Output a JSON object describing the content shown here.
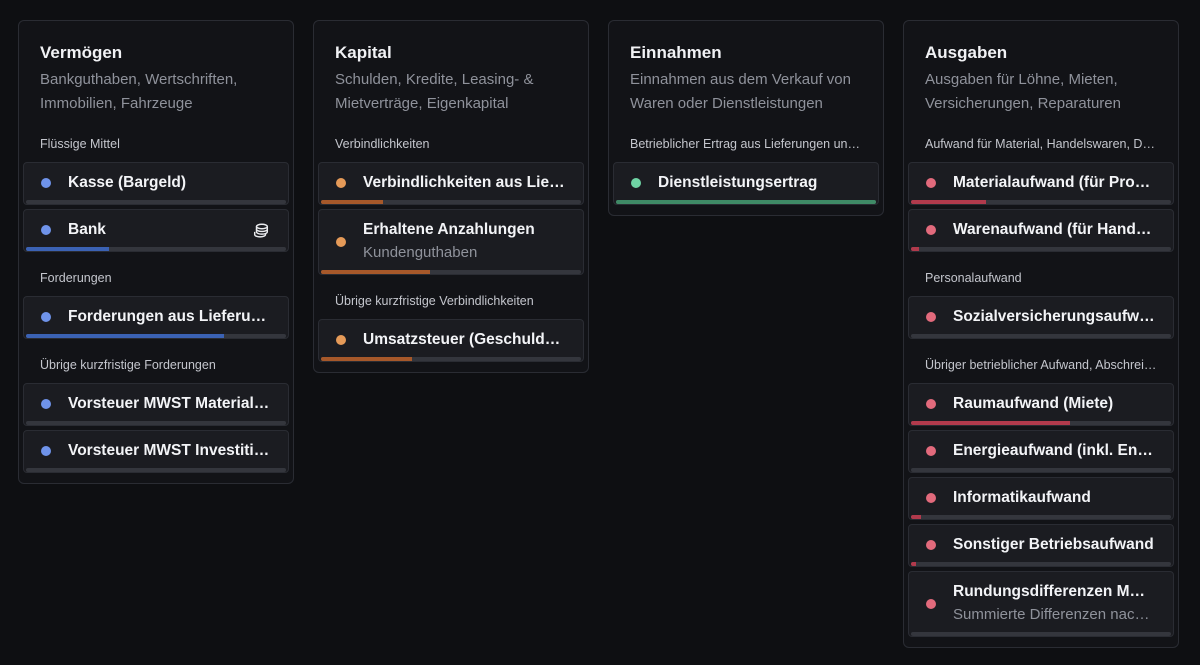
{
  "columns": [
    {
      "title": "Vermögen",
      "description": "Bankguthaben, Wertschriften, Immobilien, Fahrzeuge",
      "accent": "#6f93ea",
      "groups": [
        {
          "label": "Flüssige Mittel",
          "cards": [
            {
              "title": "Kasse (Bargeld)",
              "progress": 0.0
            },
            {
              "title": "Bank",
              "progress": 0.32,
              "icon": "coins-icon"
            }
          ]
        },
        {
          "label": "Forderungen",
          "cards": [
            {
              "title": "Forderungen aus Lieferungen und Leistungen",
              "progress": 0.76
            }
          ]
        },
        {
          "label": "Übrige kurzfristige Forderungen",
          "cards": [
            {
              "title": "Vorsteuer MWST Materialaufwand",
              "progress": 0.0
            },
            {
              "title": "Vorsteuer MWST Investitionen",
              "progress": 0.0
            }
          ]
        }
      ]
    },
    {
      "title": "Kapital",
      "description": "Schulden, Kredite, Leasing- & Mietverträge, Eigenkapital",
      "accent": "#e59a58",
      "groups": [
        {
          "label": "Verbindlichkeiten",
          "cards": [
            {
              "title": "Verbindlichkeiten aus Lieferungen und Leistungen",
              "progress": 0.24
            },
            {
              "title": "Erhaltene Anzahlungen",
              "subtitle": "Kundenguthaben",
              "progress": 0.42
            }
          ]
        },
        {
          "label": "Übrige kurzfristige Verbindlichkeiten",
          "cards": [
            {
              "title": "Umsatzsteuer (Geschuldete MWST)",
              "progress": 0.35
            }
          ]
        }
      ]
    },
    {
      "title": "Einnahmen",
      "description": "Einnahmen aus dem Verkauf von Waren oder Dienstleistungen",
      "accent": "#6fd3a4",
      "bar_color": "#3f8a66",
      "groups": [
        {
          "label": "Betrieblicher Ertrag aus Lieferungen und Leistungen",
          "cards": [
            {
              "title": "Dienstleistungsertrag",
              "progress": 1.0
            }
          ]
        }
      ]
    },
    {
      "title": "Ausgaben",
      "description": "Ausgaben für Löhne, Mieten, Versicherungen, Reparaturen",
      "accent": "#e26a7c",
      "bar_color": "#b13a4c",
      "groups": [
        {
          "label": "Aufwand für Material, Handelswaren, Drittleistungen",
          "cards": [
            {
              "title": "Materialaufwand (für Produktion)",
              "progress": 0.29
            },
            {
              "title": "Warenaufwand (für Handelswaren)",
              "progress": 0.03
            }
          ]
        },
        {
          "label": "Personalaufwand",
          "cards": [
            {
              "title": "Sozialversicherungsaufwand",
              "progress": 0.0
            }
          ]
        },
        {
          "label": "Übriger betrieblicher Aufwand, Abschreibungen",
          "cards": [
            {
              "title": "Raumaufwand (Miete)",
              "progress": 0.61
            },
            {
              "title": "Energieaufwand (inkl. Entsorgung)",
              "progress": 0.0
            },
            {
              "title": "Informatikaufwand",
              "progress": 0.04
            },
            {
              "title": "Sonstiger Betriebsaufwand",
              "progress": 0.02
            },
            {
              "title": "Rundungsdifferenzen MWST",
              "subtitle": "Summierte Differenzen nach Abrechnung",
              "progress": 0.0
            }
          ]
        }
      ]
    }
  ]
}
